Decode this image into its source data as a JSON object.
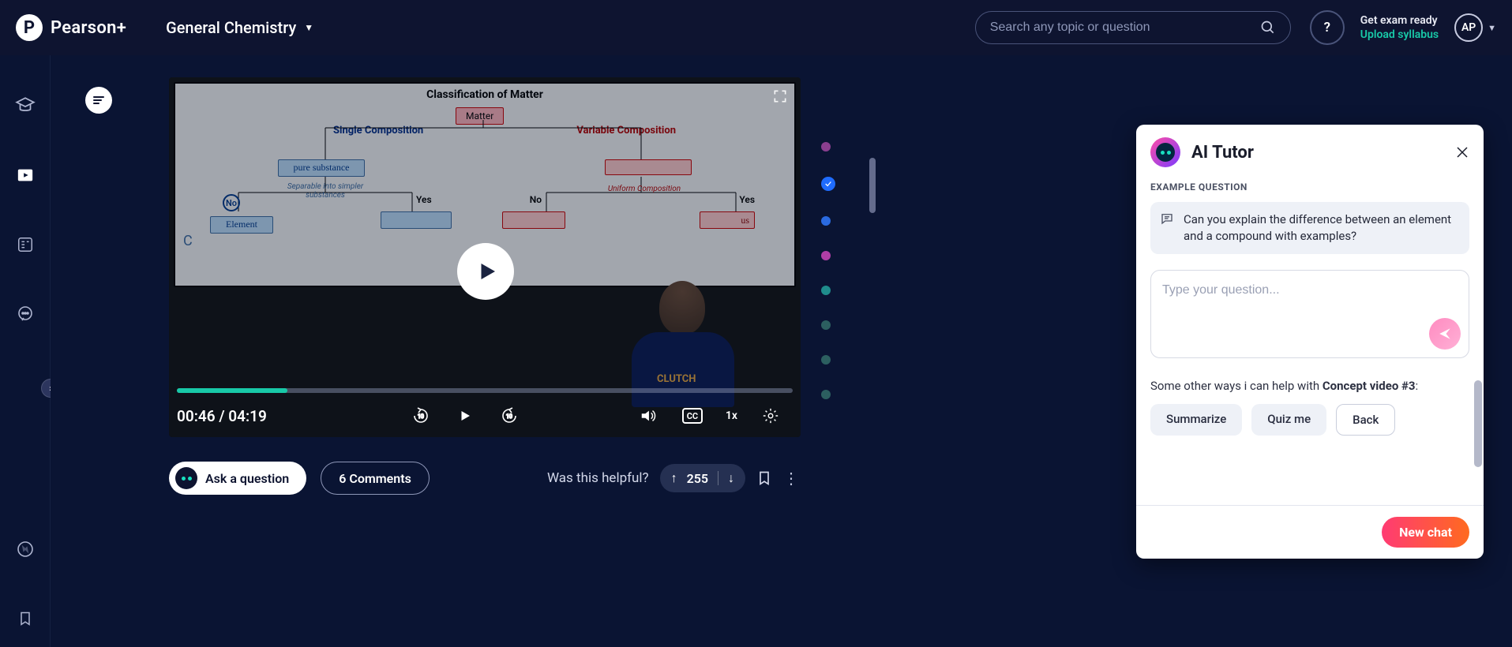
{
  "header": {
    "brand": "Pearson+",
    "brand_initial": "P",
    "course": "General Chemistry",
    "search_placeholder": "Search any topic or question",
    "help_glyph": "?",
    "exam_line1": "Get exam ready",
    "exam_line2": "Upload syllabus",
    "avatar_initials": "AP"
  },
  "video": {
    "title": "Classification of Matter",
    "root_node": "Matter",
    "single_label": "Single Composition",
    "variable_label": "Variable Composition",
    "pure_box": "pure substance",
    "separable_label": "Separable into simpler substances",
    "uniform_label": "Uniform Composition",
    "no_label": "No",
    "yes_label": "Yes",
    "element_box": "Element",
    "us_hand": "us",
    "c_mark": "C",
    "clutch": "CLUTCH",
    "timecode": "00:46 / 04:19",
    "cc": "CC",
    "speed": "1x"
  },
  "below": {
    "ask": "Ask a question",
    "comments": "6 Comments",
    "helpful": "Was this helpful?",
    "votes": "255"
  },
  "dots": [
    {
      "color": "#8a3f8f"
    },
    {
      "color": "#1f6cff",
      "check": true
    },
    {
      "color": "#2a6ae0"
    },
    {
      "color": "#b03ea6"
    },
    {
      "color": "#1f8c8c"
    },
    {
      "color": "#2c5f60"
    },
    {
      "color": "#2c5f60"
    },
    {
      "color": "#2c5f60"
    }
  ],
  "tutor": {
    "title": "AI Tutor",
    "example_label": "EXAMPLE QUESTION",
    "example_text": "Can you explain the difference between an element and a compound with examples?",
    "input_placeholder": "Type your question...",
    "help_prefix": "Some other ways i can help with ",
    "help_bold": "Concept video #3",
    "help_suffix": ":",
    "chip_summarize": "Summarize",
    "chip_quiz": "Quiz me",
    "chip_back": "Back",
    "new_chat": "New chat"
  }
}
